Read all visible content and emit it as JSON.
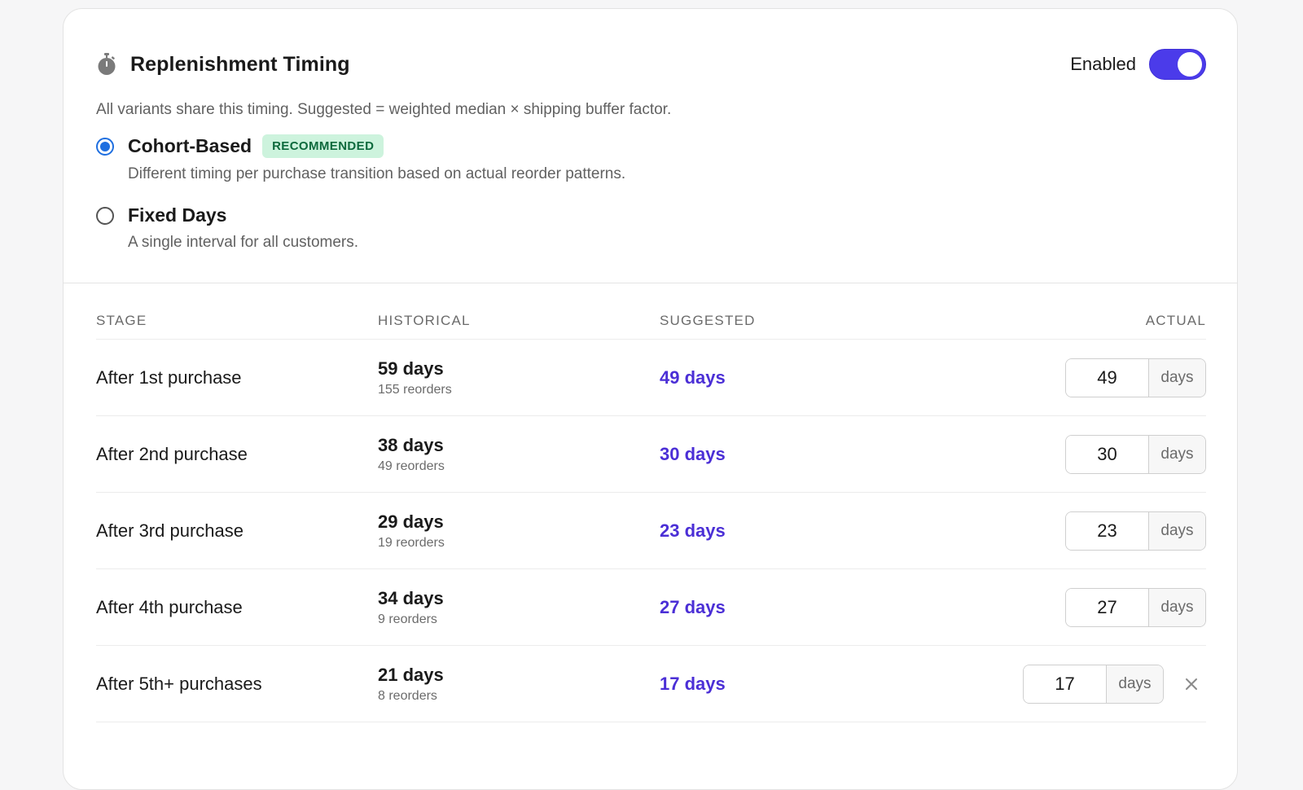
{
  "header": {
    "title": "Replenishment Timing",
    "title_icon": "stopwatch-icon",
    "toggle_label": "Enabled",
    "toggle_on": true,
    "accent_color": "#4b3bea"
  },
  "description": "All variants share this timing. Suggested = weighted median × shipping buffer factor.",
  "options": [
    {
      "label": "Cohort-Based",
      "badge": "RECOMMENDED",
      "description": "Different timing per purchase transition based on actual reorder patterns.",
      "selected": true
    },
    {
      "label": "Fixed Days",
      "description": "A single interval for all customers.",
      "selected": false
    }
  ],
  "table": {
    "columns": [
      "STAGE",
      "HISTORICAL",
      "SUGGESTED",
      "ACTUAL"
    ],
    "unit": "days",
    "rows": [
      {
        "stage": "After 1st purchase",
        "historical": "59 days",
        "reorders": "155 reorders",
        "suggested": "49 days",
        "actual": "49",
        "removable": false
      },
      {
        "stage": "After 2nd purchase",
        "historical": "38 days",
        "reorders": "49 reorders",
        "suggested": "30 days",
        "actual": "30",
        "removable": false
      },
      {
        "stage": "After 3rd purchase",
        "historical": "29 days",
        "reorders": "19 reorders",
        "suggested": "23 days",
        "actual": "23",
        "removable": false
      },
      {
        "stage": "After 4th purchase",
        "historical": "34 days",
        "reorders": "9 reorders",
        "suggested": "27 days",
        "actual": "27",
        "removable": false
      },
      {
        "stage": "After 5th+ purchases",
        "historical": "21 days",
        "reorders": "8 reorders",
        "suggested": "17 days",
        "actual": "17",
        "removable": true
      }
    ]
  }
}
